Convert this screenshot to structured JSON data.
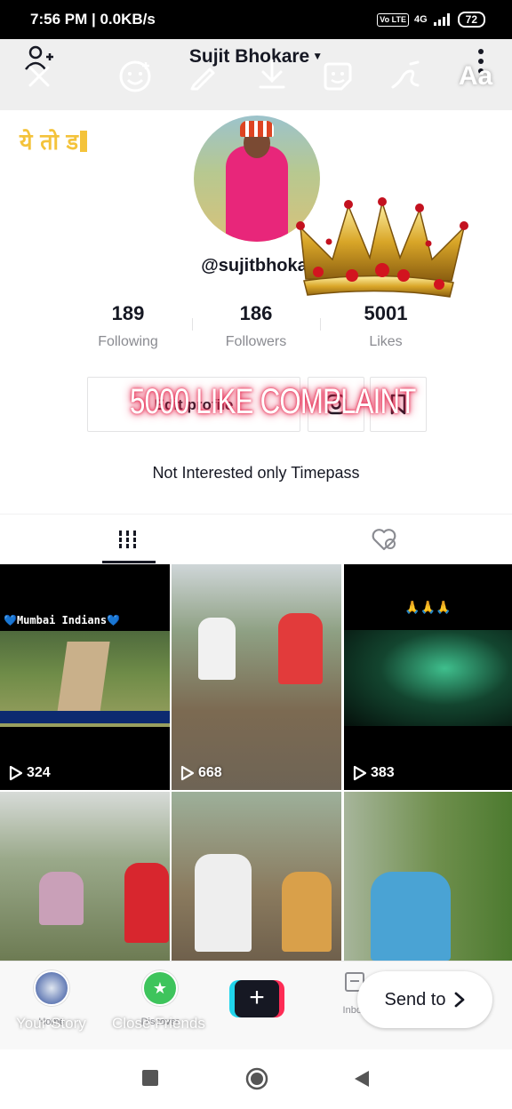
{
  "status_bar": {
    "time": "7:56 PM | 0.0KB/s",
    "volte": "Vo LTE",
    "network": "4G",
    "battery": "72"
  },
  "editor_tools": [
    "close-icon",
    "emoji-sticker-icon",
    "pen-icon",
    "download-icon",
    "sticker-icon",
    "draw-icon",
    "text-tool-icon"
  ],
  "editor": {
    "text_tool_label": "Aa",
    "typed_text": "ये तो ड"
  },
  "profile": {
    "name": "Sujit Bhokare",
    "handle": "@sujitbhoka",
    "stats": [
      {
        "value": "189",
        "label": "Following"
      },
      {
        "value": "186",
        "label": "Followers"
      },
      {
        "value": "5001",
        "label": "Likes"
      }
    ],
    "edit_label": "Edit profile",
    "bio": "Not Interested only Timepass"
  },
  "overlay_text": "5000 LIKE COMPLAINT",
  "videos": [
    {
      "plays": "324",
      "caption": "💙Mumbai Indians💙"
    },
    {
      "plays": "668"
    },
    {
      "plays": "383",
      "caption": "🙏🙏🙏"
    },
    {
      "plays": ""
    },
    {
      "plays": ""
    },
    {
      "plays": ""
    }
  ],
  "bottom_nav": {
    "home": "Home",
    "discover": "Discover",
    "inbox": "Inbox",
    "your_story": "Your Story",
    "close_friends": "Close Friends",
    "send_to": "Send to"
  },
  "colors": {
    "accent_pink": "#fe2c55",
    "accent_cyan": "#20d5ec",
    "typed_text": "#f4c33b"
  }
}
